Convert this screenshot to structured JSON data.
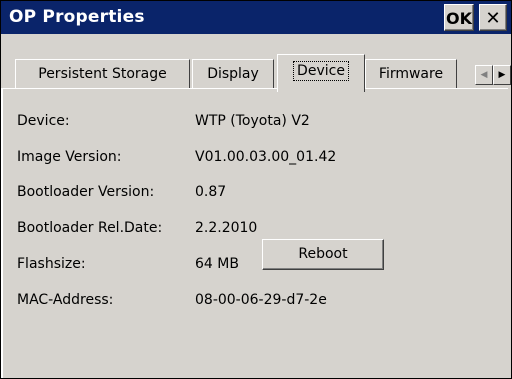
{
  "window": {
    "title": "OP Properties",
    "ok_label": "OK",
    "close_label": "✕"
  },
  "tabs": [
    {
      "label": "Persistent Storage",
      "selected": false
    },
    {
      "label": "Display",
      "selected": false
    },
    {
      "label": "Device",
      "selected": true
    },
    {
      "label": "Firmware",
      "selected": false
    }
  ],
  "tab_scroll": {
    "left_icon": "◀",
    "right_icon": "▶"
  },
  "device_info": [
    {
      "label": "Device:",
      "value": "WTP (Toyota) V2"
    },
    {
      "label": "Image Version:",
      "value": "V01.00.03.00_01.42"
    },
    {
      "label": "Bootloader Version:",
      "value": "0.87"
    },
    {
      "label": "Bootloader Rel.Date:",
      "value": "2.2.2010"
    },
    {
      "label": "Flashsize:",
      "value": "64 MB"
    },
    {
      "label": "MAC-Address:",
      "value": "08-00-06-29-d7-2e"
    }
  ],
  "actions": {
    "reboot_label": "Reboot"
  },
  "colors": {
    "titlebar": "#0a246a",
    "face": "#d6d3ce"
  }
}
